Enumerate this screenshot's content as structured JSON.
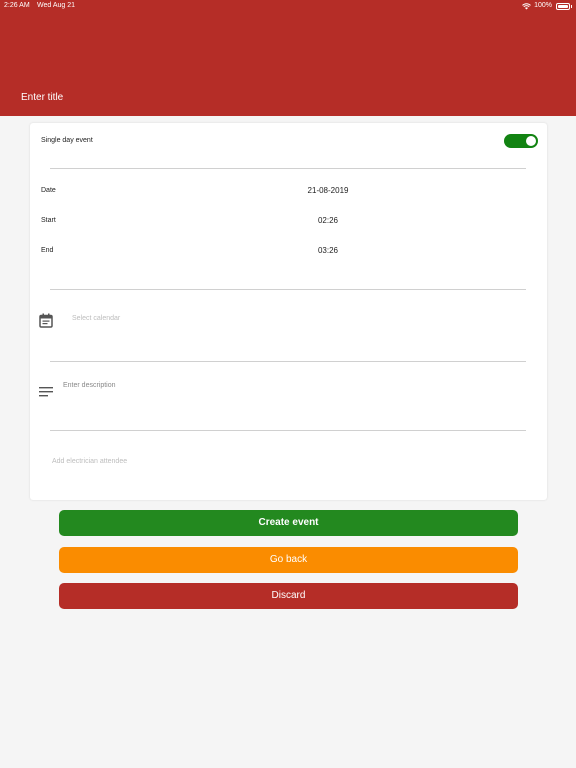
{
  "status_bar": {
    "time": "2:26 AM",
    "date": "Wed Aug 21",
    "battery": "100%"
  },
  "header": {
    "title": "Enter title"
  },
  "form": {
    "single_day_label": "Single day event",
    "single_day_on": true,
    "date_label": "Date",
    "date_value": "21-08-2019",
    "start_label": "Start",
    "start_value": "02:26",
    "end_label": "End",
    "end_value": "03:26",
    "calendar_placeholder": "Select calendar",
    "description_placeholder": "Enter description",
    "attendee_placeholder": "Add electrician attendee"
  },
  "buttons": {
    "create_label": "Create event",
    "back_label": "Go back",
    "discard_label": "Discard"
  },
  "colors": {
    "header": "#b52d27",
    "toggle_on": "#128312",
    "create": "#23891f",
    "back": "#fa8c00",
    "discard": "#b52d27"
  }
}
